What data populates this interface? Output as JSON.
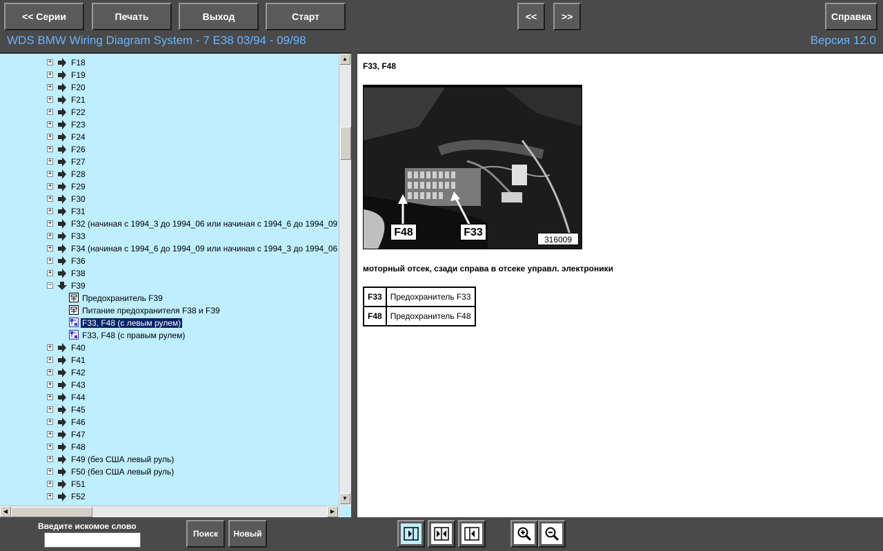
{
  "toolbar": {
    "series_label": "<< Серии",
    "print_label": "Печать",
    "exit_label": "Выход",
    "start_label": "Старт",
    "prev_label": "<<",
    "next_label": ">>",
    "help_label": "Справка"
  },
  "header": {
    "title": "WDS BMW Wiring Diagram System - 7 E38 03/94 - 09/98",
    "version": "Версия 12.0"
  },
  "tree": {
    "items_before": [
      {
        "label": "F18"
      },
      {
        "label": "F19"
      },
      {
        "label": "F20"
      },
      {
        "label": "F21"
      },
      {
        "label": "F22"
      },
      {
        "label": "F23"
      },
      {
        "label": "F24"
      },
      {
        "label": "F26"
      },
      {
        "label": "F27"
      },
      {
        "label": "F28"
      },
      {
        "label": "F29"
      },
      {
        "label": "F30"
      },
      {
        "label": "F31"
      },
      {
        "label": "F32 (начиная с 1994_3 до 1994_06 или начиная с 1994_6 до 1994_09"
      },
      {
        "label": "F33"
      },
      {
        "label": "F34 (начиная с 1994_6 до 1994_09 или начиная с 1994_3 до 1994_06"
      },
      {
        "label": "F36"
      },
      {
        "label": "F38"
      }
    ],
    "expanded": {
      "label": "F39",
      "children": [
        {
          "label": "Предохранитель F39",
          "icon": "schematic-icon"
        },
        {
          "label": "Питание предохранителя F38 и F39",
          "icon": "schematic-icon"
        },
        {
          "label": "F33, F48 (с левым рулем)",
          "icon": "location-icon",
          "selected": true
        },
        {
          "label": "F33, F48 (с правым рулем)",
          "icon": "location-icon"
        }
      ]
    },
    "items_after": [
      {
        "label": "F40"
      },
      {
        "label": "F41"
      },
      {
        "label": "F42"
      },
      {
        "label": "F43"
      },
      {
        "label": "F44"
      },
      {
        "label": "F45"
      },
      {
        "label": "F46"
      },
      {
        "label": "F47"
      },
      {
        "label": "F48"
      },
      {
        "label": "F49 (без США левый руль)"
      },
      {
        "label": "F50 (без США левый руль)"
      },
      {
        "label": "F51"
      },
      {
        "label": "F52"
      }
    ]
  },
  "document": {
    "title": "F33, F48",
    "photo_label_f48": "F48",
    "photo_label_f33": "F33",
    "photo_number": "316009",
    "caption": "моторный отсек, сзади справа в отсеке управл. электроники",
    "table": [
      {
        "code": "F33",
        "desc": "Предохранитель F33"
      },
      {
        "code": "F48",
        "desc": "Предохранитель F48"
      }
    ]
  },
  "bottom": {
    "search_label": "Введите искомое слово",
    "search_value": "",
    "search_button": "Поиск",
    "new_button": "Новый"
  },
  "colors": {
    "accent": "#6ab4ff",
    "tree_bg": "#bfeeff",
    "chrome": "#4a4a4a",
    "selection": "#0a246a"
  }
}
